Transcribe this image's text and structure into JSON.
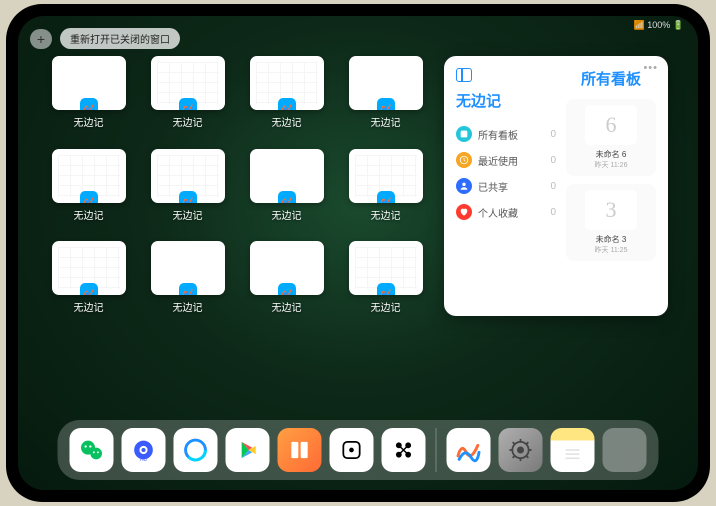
{
  "status_bar": {
    "indicators": "📶 100% 🔋"
  },
  "top": {
    "plus": "+",
    "reopen_label": "重新打开已关闭的窗口"
  },
  "thumbs": [
    {
      "label": "无边记",
      "variant": "blank"
    },
    {
      "label": "无边记",
      "variant": "calendar"
    },
    {
      "label": "无边记",
      "variant": "calendar"
    },
    {
      "label": "无边记",
      "variant": "blank"
    },
    {
      "label": "无边记",
      "variant": "calendar"
    },
    {
      "label": "无边记",
      "variant": "calendar"
    },
    {
      "label": "无边记",
      "variant": "blank"
    },
    {
      "label": "无边记",
      "variant": "calendar"
    },
    {
      "label": "无边记",
      "variant": "calendar"
    },
    {
      "label": "无边记",
      "variant": "blank"
    },
    {
      "label": "无边记",
      "variant": "blank"
    },
    {
      "label": "无边记",
      "variant": "calendar"
    }
  ],
  "panel": {
    "left_title": "无边记",
    "right_title": "所有看板",
    "categories": [
      {
        "label": "所有看板",
        "count": "0",
        "color": "#24c6dc"
      },
      {
        "label": "最近使用",
        "count": "0",
        "color": "#f5a623"
      },
      {
        "label": "已共享",
        "count": "0",
        "color": "#2e6dff"
      },
      {
        "label": "个人收藏",
        "count": "0",
        "color": "#ff3b30"
      }
    ],
    "boards": [
      {
        "sketch": "6",
        "name": "未命名 6",
        "time": "昨天 11:26"
      },
      {
        "sketch": "3",
        "name": "未命名 3",
        "time": "昨天 11:25"
      }
    ]
  },
  "dock": [
    {
      "name": "wechat",
      "bg": "#ffffff"
    },
    {
      "name": "quark",
      "bg": "#ffffff"
    },
    {
      "name": "qqbrowser",
      "bg": "#ffffff"
    },
    {
      "name": "play",
      "bg": "#ffffff"
    },
    {
      "name": "books",
      "bg": "linear-gradient(135deg,#ff9f43,#ff6b35)"
    },
    {
      "name": "dice",
      "bg": "#ffffff"
    },
    {
      "name": "connect",
      "bg": "#ffffff"
    },
    {
      "name": "freeform",
      "bg": "#ffffff"
    },
    {
      "name": "settings",
      "bg": "linear-gradient(135deg,#b0b0b0,#7a7a7a)"
    },
    {
      "name": "notes",
      "bg": "linear-gradient(#ffe680 28%,#fff 28%)"
    }
  ]
}
